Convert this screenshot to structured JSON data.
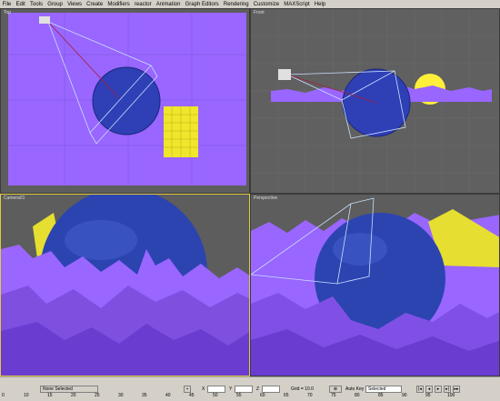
{
  "menu": [
    "File",
    "Edit",
    "Tools",
    "Group",
    "Views",
    "Create",
    "Modifiers",
    "reactor",
    "Animation",
    "Graph Editors",
    "Rendering",
    "Customize",
    "MAXScript",
    "Help"
  ],
  "viewports": {
    "top": "Top",
    "front": "Front",
    "camera": "Camera01",
    "perspective": "Perspective"
  },
  "status": {
    "selection": "None Selected",
    "x_label": "X",
    "y_label": "Y",
    "z_label": "Z",
    "grid": "Grid = 10.0",
    "auto_key": "Auto Key",
    "selected": "Selected"
  },
  "timeline_ticks": [
    "0",
    "10",
    "15",
    "20",
    "25",
    "30",
    "35",
    "40",
    "45",
    "50",
    "55",
    "60",
    "65",
    "70",
    "75",
    "80",
    "85",
    "90",
    "95",
    "100"
  ],
  "colors": {
    "viewport_bg": "#5d5d5d",
    "terrain": "#9d6cf0",
    "sphere": "#2c44b0",
    "cylinder": "#e6de30",
    "active_border": "#e0c840"
  }
}
